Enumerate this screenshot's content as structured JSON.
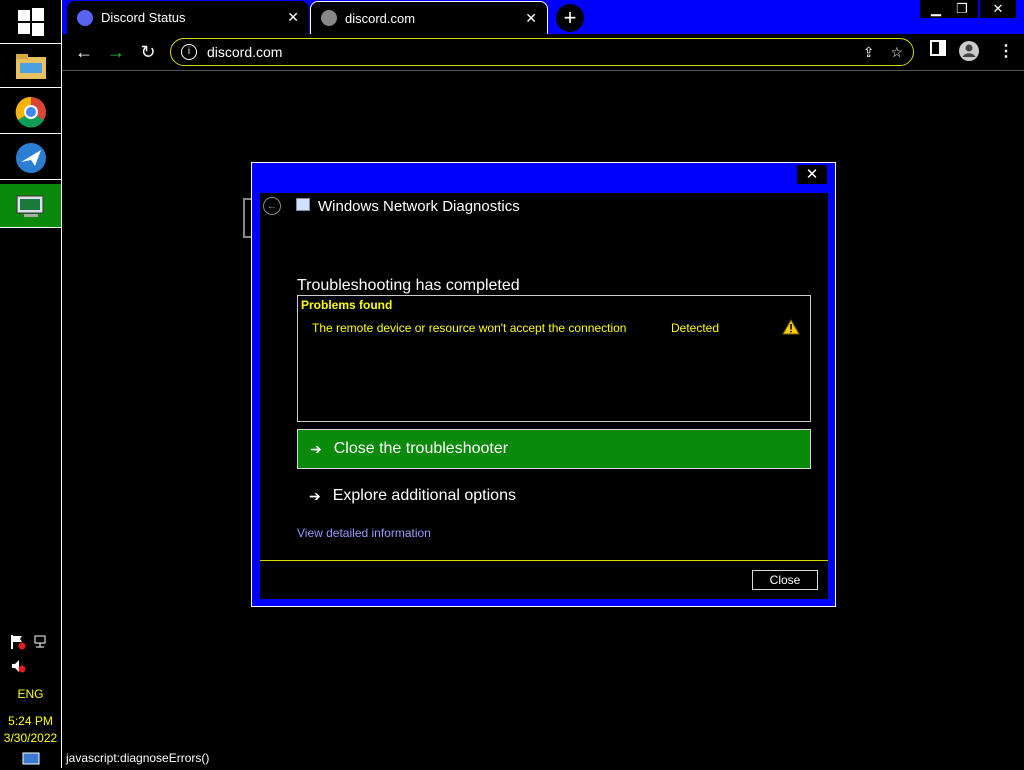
{
  "taskbar": {
    "icons": [
      "windows-start-icon",
      "file-explorer-icon",
      "chrome-icon",
      "remote-desktop-icon",
      "network-diagnostics-icon"
    ],
    "tray": {
      "language": "ENG",
      "time": "5:24 PM",
      "date": "3/30/2022"
    }
  },
  "browser": {
    "tabs": [
      {
        "title": "Discord Status",
        "icon": "discord-icon"
      },
      {
        "title": "discord.com",
        "icon": "globe-icon"
      }
    ],
    "address": "discord.com",
    "status_text": "javascript:diagnoseErrors()"
  },
  "dialog": {
    "title": "Windows Network Diagnostics",
    "heading": "Troubleshooting has completed",
    "problems_title": "Problems found",
    "problem": {
      "description": "The remote device or resource won't accept the connection",
      "status": "Detected"
    },
    "primary_option": "Close the troubleshooter",
    "secondary_option": "Explore additional options",
    "detail_link": "View detailed information",
    "close_button": "Close"
  },
  "colors": {
    "accent_blue": "#0000ff",
    "accent_green": "#0a8a0a",
    "text_yellow": "#ffff00",
    "link_purple": "#9999ff"
  }
}
